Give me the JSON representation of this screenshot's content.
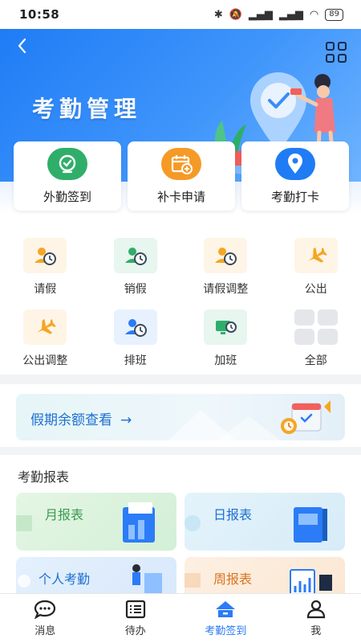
{
  "status_bar": {
    "time": "10:58",
    "battery": "89"
  },
  "header": {
    "title": "考勤管理"
  },
  "quick_actions": [
    {
      "label": "外勤签到",
      "color": "#2fae6a"
    },
    {
      "label": "补卡申请",
      "color": "#f59a26"
    },
    {
      "label": "考勤打卡",
      "color": "#1f7cf5"
    }
  ],
  "functions": [
    {
      "label": "请假",
      "icon": "person-clock-icon",
      "color": "#f5a623",
      "bg": "#fff5e6"
    },
    {
      "label": "销假",
      "icon": "person-clock-icon",
      "color": "#2fae6a",
      "bg": "#e7f6ee"
    },
    {
      "label": "请假调整",
      "icon": "person-clock-icon",
      "color": "#f5a623",
      "bg": "#fff5e6"
    },
    {
      "label": "公出",
      "icon": "airplane-icon",
      "color": "#f5a623",
      "bg": "#fff5e6"
    },
    {
      "label": "公出调整",
      "icon": "airplane-icon",
      "color": "#f5a623",
      "bg": "#fff5e6"
    },
    {
      "label": "排班",
      "icon": "person-clock-icon",
      "color": "#2b7cf6",
      "bg": "#e8f1fe"
    },
    {
      "label": "加班",
      "icon": "monitor-clock-icon",
      "color": "#2fae6a",
      "bg": "#e7f6ee"
    },
    {
      "label": "全部",
      "icon": "grid-icon",
      "color": "#c9ccd2",
      "bg": "#ffffff"
    }
  ],
  "banner": {
    "text": "假期余额查看",
    "arrow": "→"
  },
  "reports": {
    "title": "考勤报表",
    "cards": [
      {
        "label": "月报表",
        "color": "#3a9a4e"
      },
      {
        "label": "日报表",
        "color": "#1d6fd1"
      },
      {
        "label": "个人考勤",
        "color": "#1d6fd1"
      },
      {
        "label": "周报表",
        "color": "#d9731f"
      }
    ]
  },
  "tabs": [
    {
      "label": "消息",
      "icon": "message-icon",
      "active": false
    },
    {
      "label": "待办",
      "icon": "todo-list-icon",
      "active": false
    },
    {
      "label": "考勤签到",
      "icon": "home-icon",
      "active": true
    },
    {
      "label": "我",
      "icon": "user-icon",
      "active": false
    }
  ]
}
